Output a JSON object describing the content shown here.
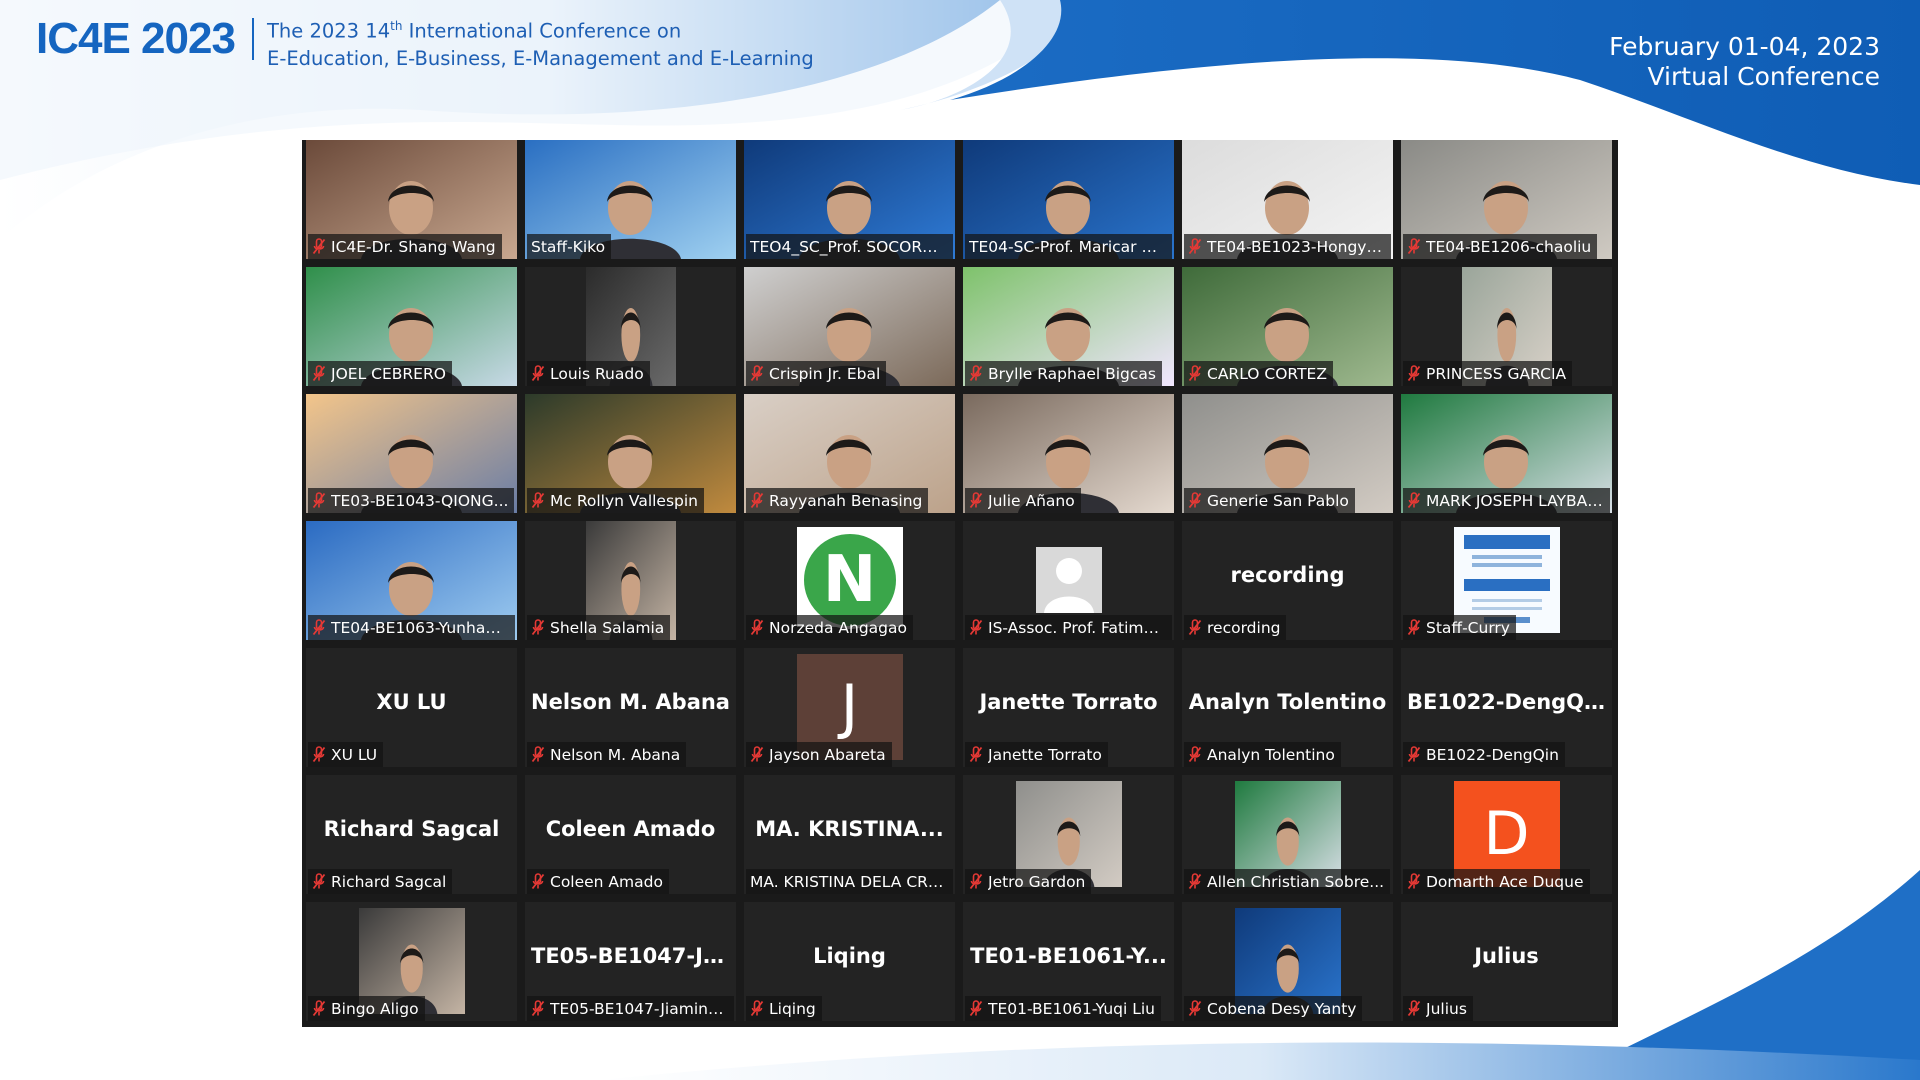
{
  "header": {
    "logo_text": "IC4E 2023",
    "title_prefix": "The 2023 14",
    "title_suffix_sup": "th",
    "title_line1_rest": " International Conference on",
    "title_line2": "E-Education, E-Business, E-Management and E-Learning",
    "date_line1": "February 01-04, 2023",
    "date_line2": "Virtual Conference"
  },
  "colors": {
    "brand_blue": "#1565c0",
    "gallery_bg": "#1a1a1a",
    "tile_bg": "#232323",
    "active_speaker_border": "#f3f07a",
    "muted_mic": "#e53935"
  },
  "participants": [
    {
      "label": "IC4E-Dr. Shang Wang",
      "kind": "video",
      "muted": true
    },
    {
      "label": "Staff-Kiko",
      "kind": "video",
      "muted": false,
      "active": true
    },
    {
      "label": "TEO4_SC_Prof. SOCORRO...",
      "kind": "video",
      "muted": false
    },
    {
      "label": "TE04-SC-Prof. Maricar Pru...",
      "kind": "video",
      "muted": false
    },
    {
      "label": "TE04-BE1023-Hongya...",
      "kind": "video",
      "muted": true
    },
    {
      "label": "TE04-BE1206-chaoliu",
      "kind": "video",
      "muted": true
    },
    {
      "label": "JOEL CEBRERO",
      "kind": "video",
      "muted": true
    },
    {
      "label": "Louis Ruado",
      "kind": "video-narrow",
      "muted": true
    },
    {
      "label": "Crispin Jr. Ebal",
      "kind": "video",
      "muted": true
    },
    {
      "label": "Brylle Raphael Bigcas",
      "kind": "video",
      "muted": true
    },
    {
      "label": "CARLO CORTEZ",
      "kind": "video",
      "muted": true
    },
    {
      "label": "PRINCESS GARCIA",
      "kind": "video-narrow",
      "muted": true
    },
    {
      "label": "TE03-BE1043-QIONG...",
      "kind": "video",
      "muted": true
    },
    {
      "label": "Mc Rollyn Vallespin",
      "kind": "video",
      "muted": true
    },
    {
      "label": "Rayyanah Benasing",
      "kind": "video",
      "muted": true
    },
    {
      "label": "Julie Añano",
      "kind": "video",
      "muted": true
    },
    {
      "label": "Generie San Pablo",
      "kind": "video",
      "muted": true
    },
    {
      "label": "MARK JOSEPH  LAYBA ...",
      "kind": "video",
      "muted": true
    },
    {
      "label": "TE04-BE1063-Yunhao Li",
      "kind": "video",
      "muted": true
    },
    {
      "label": "Shella Salamia",
      "kind": "video-narrow",
      "muted": true
    },
    {
      "label": "Norzeda Angagao",
      "kind": "letter-circle",
      "letter": "N",
      "letter_color": "#3aa64a",
      "muted": true
    },
    {
      "label": "IS-Assoc. Prof. Fatima ...",
      "kind": "default-avatar",
      "muted": true
    },
    {
      "label": "recording",
      "kind": "name",
      "center_name": "recording",
      "muted": true
    },
    {
      "label": "Staff-Curry",
      "kind": "poster",
      "muted": true
    },
    {
      "label": "XU LU",
      "kind": "name",
      "center_name": "XU LU",
      "muted": true
    },
    {
      "label": "Nelson M. Abana",
      "kind": "name",
      "center_name": "Nelson M. Abana",
      "muted": true
    },
    {
      "label": "Jayson Abareta",
      "kind": "letter-square",
      "letter": "J",
      "letter_color": "#5d4037",
      "muted": true
    },
    {
      "label": "Janette Torrato",
      "kind": "name",
      "center_name": "Janette Torrato",
      "muted": true
    },
    {
      "label": "Analyn Tolentino",
      "kind": "name",
      "center_name": "Analyn Tolentino",
      "muted": true
    },
    {
      "label": "BE1022-DengQin",
      "kind": "name",
      "center_name": "BE1022-DengQin",
      "muted": true
    },
    {
      "label": "Richard Sagcal",
      "kind": "name",
      "center_name": "Richard Sagcal",
      "muted": true
    },
    {
      "label": "Coleen Amado",
      "kind": "name",
      "center_name": "Coleen Amado",
      "muted": true
    },
    {
      "label": "MA. KRISTINA DELA CRUZ",
      "kind": "name",
      "center_name": "MA.  KRISTINA...",
      "muted": false
    },
    {
      "label": "Jetro Gardon",
      "kind": "avatar-photo",
      "muted": true
    },
    {
      "label": "Allen Christian Sobre...",
      "kind": "avatar-photo",
      "muted": true
    },
    {
      "label": "Domarth Ace Duque",
      "kind": "letter-square",
      "letter": "D",
      "letter_color": "#f4511e",
      "muted": true
    },
    {
      "label": "Bingo Aligo",
      "kind": "avatar-photo",
      "muted": true
    },
    {
      "label": "TE05-BE1047-Jiamin D...",
      "kind": "name",
      "center_name": "TE05-BE1047-Ji...",
      "muted": true
    },
    {
      "label": "Liqing",
      "kind": "name",
      "center_name": "Liqing",
      "muted": true
    },
    {
      "label": "TE01-BE1061-Yuqi Liu",
      "kind": "name",
      "center_name": "TE01-BE1061-Y...",
      "muted": true
    },
    {
      "label": "Cobena Desy Yanty",
      "kind": "avatar-photo",
      "muted": true
    },
    {
      "label": "Julius",
      "kind": "name",
      "center_name": "Julius",
      "muted": true
    }
  ]
}
